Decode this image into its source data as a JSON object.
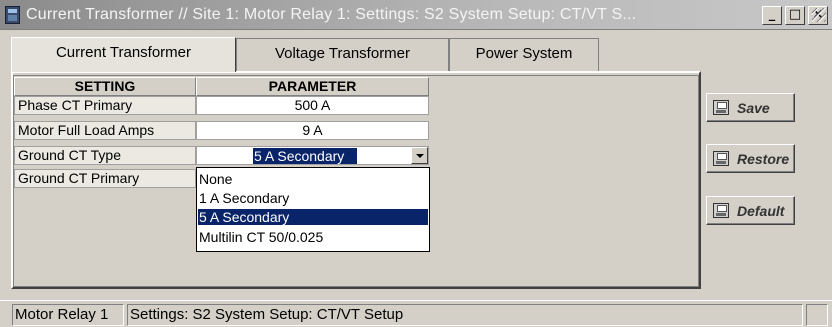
{
  "window": {
    "title": "Current Transformer // Site 1: Motor Relay 1: Settings: S2 System Setup: CT/VT S...",
    "min_glyph": "_",
    "max_glyph": "□",
    "close_glyph": "×"
  },
  "tabs": [
    {
      "label": "Current Transformer",
      "active": true
    },
    {
      "label": "Voltage Transformer",
      "active": false
    },
    {
      "label": "Power System",
      "active": false
    }
  ],
  "table": {
    "headers": [
      "SETTING",
      "PARAMETER"
    ],
    "rows": [
      {
        "setting": "Phase CT Primary",
        "parameter": "500 A"
      },
      {
        "setting": "Motor Full Load Amps",
        "parameter": "9 A"
      },
      {
        "setting": "Ground CT Type",
        "parameter": "5 A Secondary"
      },
      {
        "setting": "Ground CT Primary",
        "parameter": ""
      }
    ]
  },
  "dropdown": {
    "selected": "5 A Secondary",
    "options": [
      "None",
      "1 A Secondary",
      "5 A Secondary",
      "Multilin CT 50/0.025"
    ]
  },
  "buttons": {
    "save": "Save",
    "restore": "Restore",
    "default": "Default"
  },
  "icons": [
    "app-icon",
    "save-icon",
    "restore-icon",
    "default-icon",
    "dropdown-arrow-icon",
    "resize-grip-icon"
  ],
  "colors": {
    "selection": "#0a246a",
    "title_text": "#f4f4f4",
    "face": "#d4d0c8"
  },
  "status": {
    "device": "Motor Relay 1",
    "path": "Settings: S2 System Setup: CT/VT Setup"
  }
}
